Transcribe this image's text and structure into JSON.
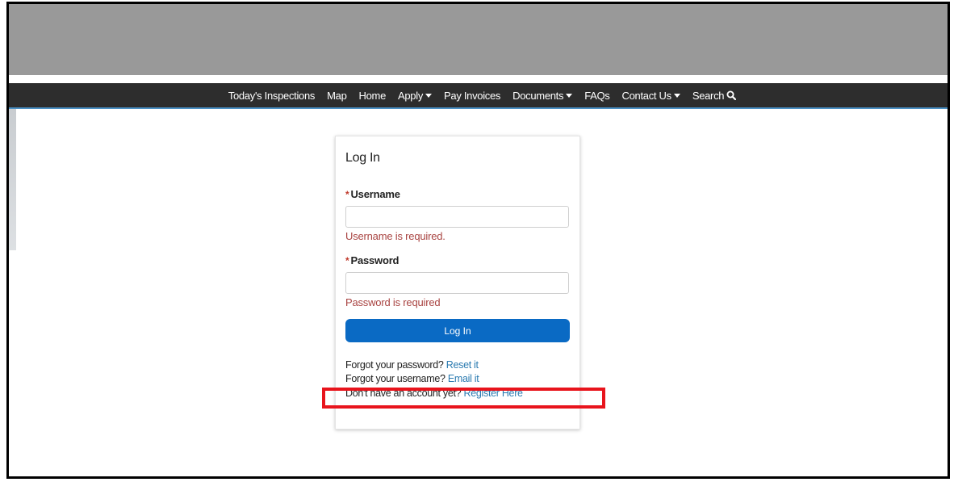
{
  "nav": {
    "items": [
      {
        "label": "Today's Inspections",
        "dropdown": false
      },
      {
        "label": "Map",
        "dropdown": false
      },
      {
        "label": "Home",
        "dropdown": false
      },
      {
        "label": "Apply",
        "dropdown": true
      },
      {
        "label": "Pay Invoices",
        "dropdown": false
      },
      {
        "label": "Documents",
        "dropdown": true
      },
      {
        "label": "FAQs",
        "dropdown": false
      },
      {
        "label": "Contact Us",
        "dropdown": true
      },
      {
        "label": "Search",
        "icon": "search-icon"
      }
    ]
  },
  "login": {
    "title": "Log In",
    "required_marker": "*",
    "username_label": "Username",
    "username_value": "",
    "username_error": "Username is required.",
    "password_label": "Password",
    "password_value": "",
    "password_error": "Password is required",
    "submit_label": "Log In",
    "forgot_password_text": "Forgot your password?",
    "forgot_password_link": "Reset it",
    "forgot_username_text": "Forgot your username?",
    "forgot_username_link": "Email it",
    "register_text": "Don't have an account yet?",
    "register_link": "Register Here"
  },
  "colors": {
    "banner": "#999999",
    "nav_background": "#2d2d2d",
    "primary_button": "#0a6ac4",
    "link": "#2a7ab0",
    "error": "#a94442",
    "highlight": "#e8141c"
  }
}
